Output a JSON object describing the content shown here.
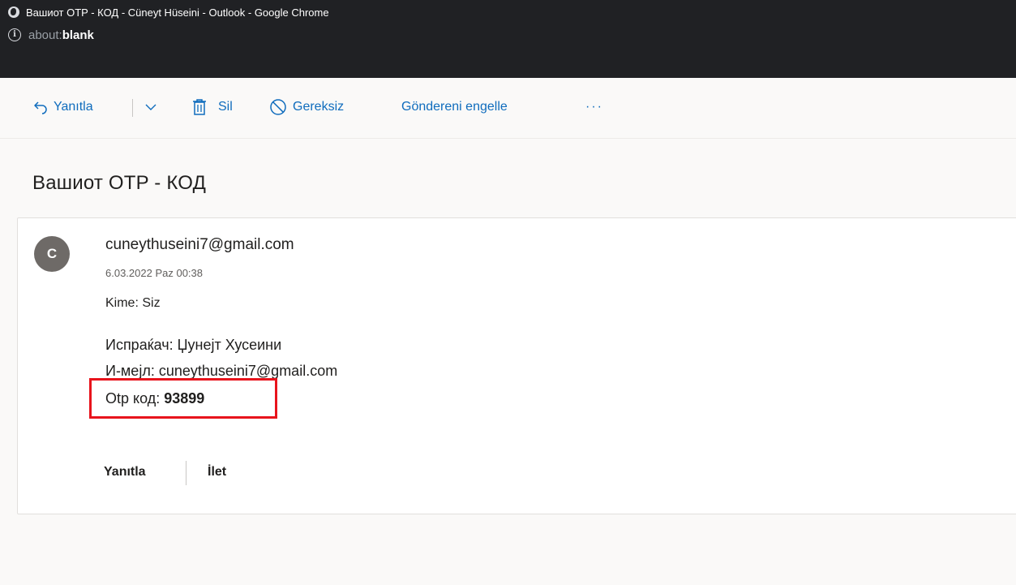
{
  "window": {
    "title": "Вашиот OTP - КОД - Cüneyt Hüseini - Outlook - Google Chrome",
    "address_scheme": "about:",
    "address_path": "blank"
  },
  "toolbar": {
    "reply_label": "Yanıtla",
    "delete_label": "Sil",
    "junk_label": "Gereksiz",
    "block_label": "Göndereni engelle",
    "more_label": "···"
  },
  "message": {
    "subject": "Вашиот OTP - КОД",
    "avatar_letter": "C",
    "sender": "cuneythuseini7@gmail.com",
    "date": "6.03.2022 Paz 00:38",
    "to_label": "Kime:",
    "to_value": "Siz",
    "body": {
      "line1": "Испраќач: Џунејт Хусеини",
      "line2": "И-мејл: cuneythuseini7@gmail.com",
      "otp_label": "Otp код: ",
      "otp_value": "93899"
    },
    "actions": {
      "reply": "Yanıtla",
      "forward": "İlet"
    }
  },
  "colors": {
    "accent": "#0f6cbd",
    "highlight": "#e8141c",
    "avatar": "#6e6a67"
  }
}
